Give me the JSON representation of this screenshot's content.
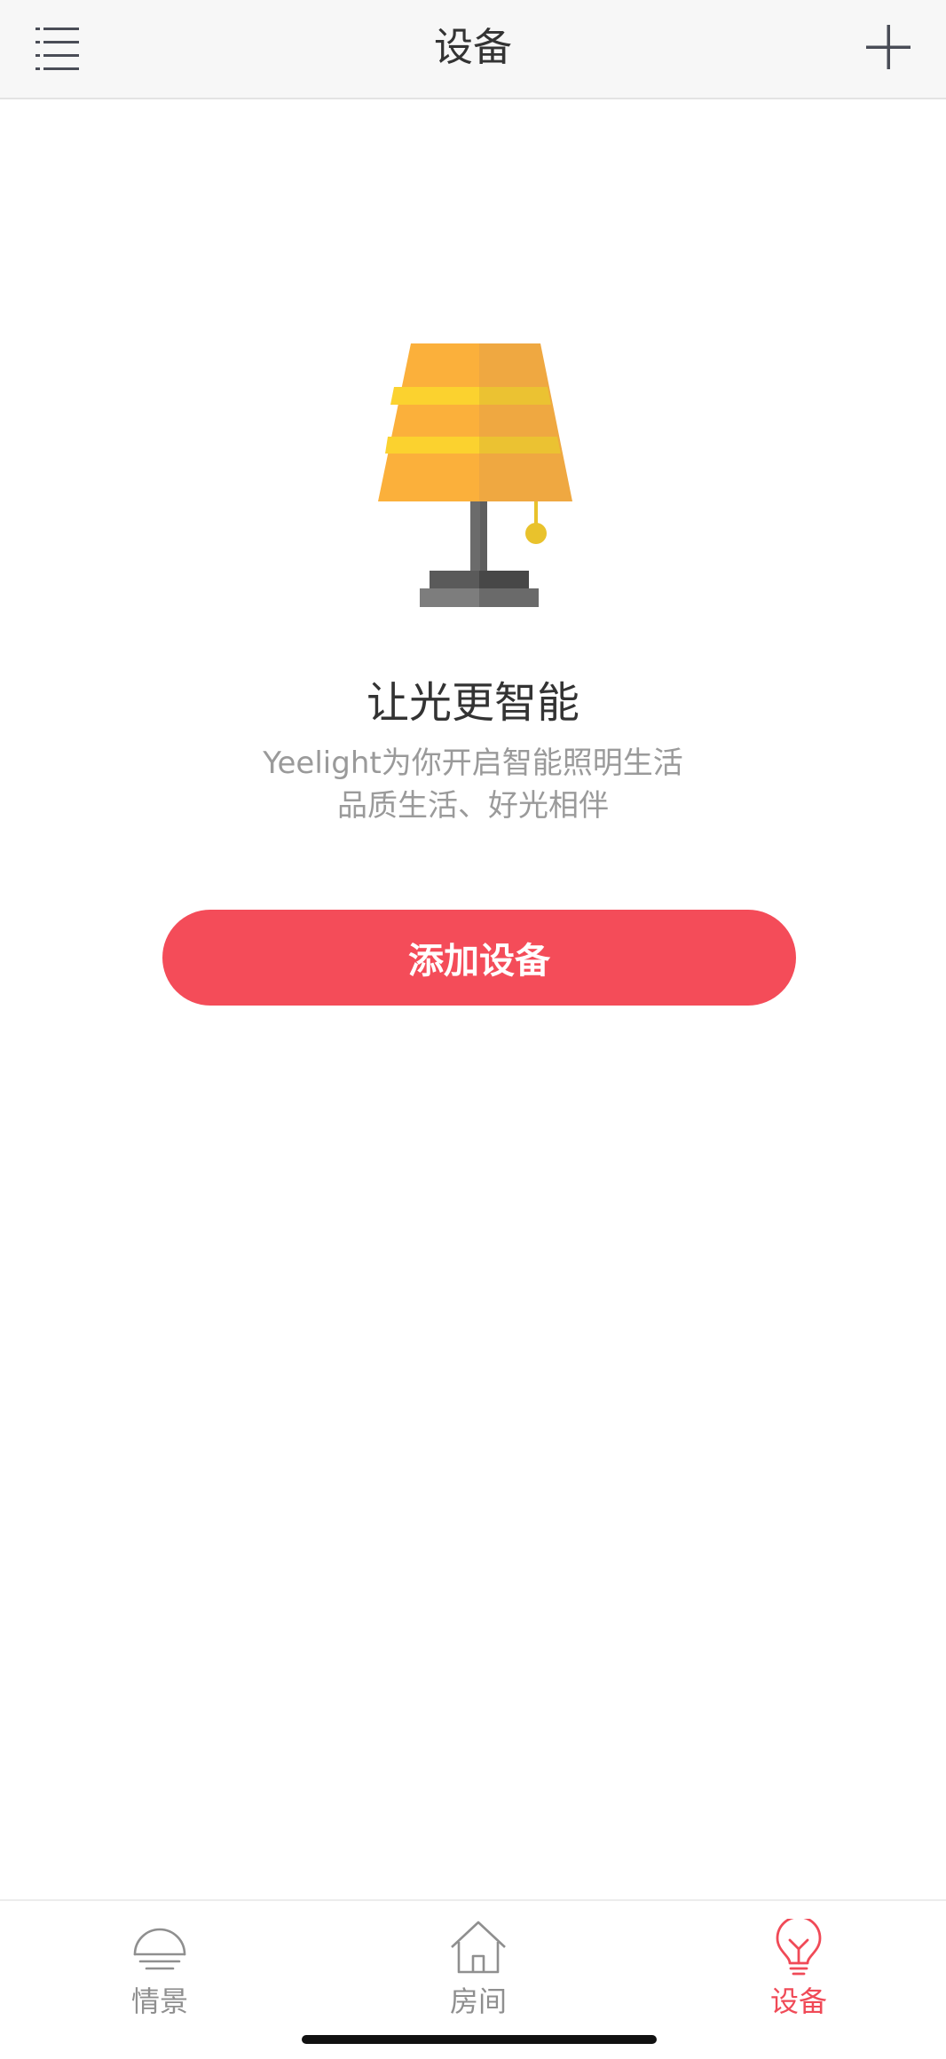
{
  "header": {
    "title": "设备",
    "menu_icon": "list-menu-icon",
    "add_icon": "plus-icon"
  },
  "empty_state": {
    "illustration": "table-lamp-illustration",
    "headline": "让光更智能",
    "subtitle_line1": "Yeelight为你开启智能照明生活",
    "subtitle_line2": "品质生活、好光相伴",
    "cta_label": "添加设备"
  },
  "tabs": [
    {
      "label": "情景",
      "icon": "scene-lamp-icon",
      "active": false
    },
    {
      "label": "房间",
      "icon": "house-icon",
      "active": false
    },
    {
      "label": "设备",
      "icon": "bulb-icon",
      "active": true
    }
  ],
  "colors": {
    "accent": "#f44c59",
    "active_tab": "#f04a57",
    "inactive_tab": "#8f8f8f",
    "lamp_shade": "#fbb03b",
    "lamp_stripe": "#fbd22f",
    "lamp_pull": "#e9c22c",
    "lamp_pole": "#6b6b6b"
  }
}
